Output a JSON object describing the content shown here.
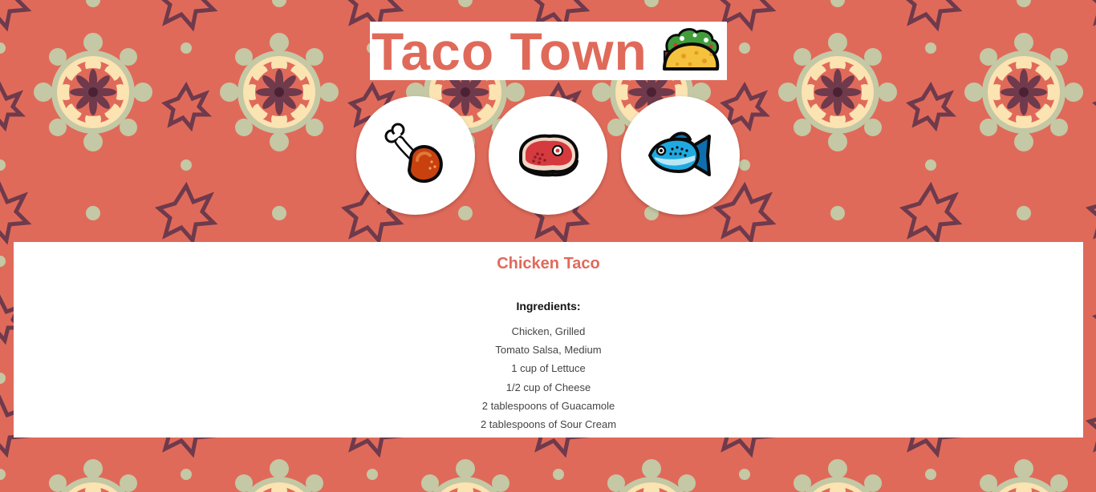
{
  "header": {
    "title": "Taco Town"
  },
  "icons": {
    "title_icon": "taco-icon",
    "protein_buttons": [
      "chicken-leg-icon",
      "steak-icon",
      "fish-icon"
    ]
  },
  "recipe": {
    "title": "Chicken Taco",
    "ingredients_heading": "Ingredients:",
    "ingredients": [
      "Chicken, Grilled",
      "Tomato Salsa, Medium",
      "1 cup of Lettuce",
      "1/2 cup of Cheese",
      "2 tablespoons of Guacamole",
      "2 tablespoons of Sour Cream"
    ]
  },
  "colors": {
    "accent": "#e06a5a",
    "pattern_sage": "#c4c8a4",
    "pattern_cream": "#fbe3b2",
    "pattern_plum": "#6e3a4c",
    "panel": "#ffffff"
  }
}
